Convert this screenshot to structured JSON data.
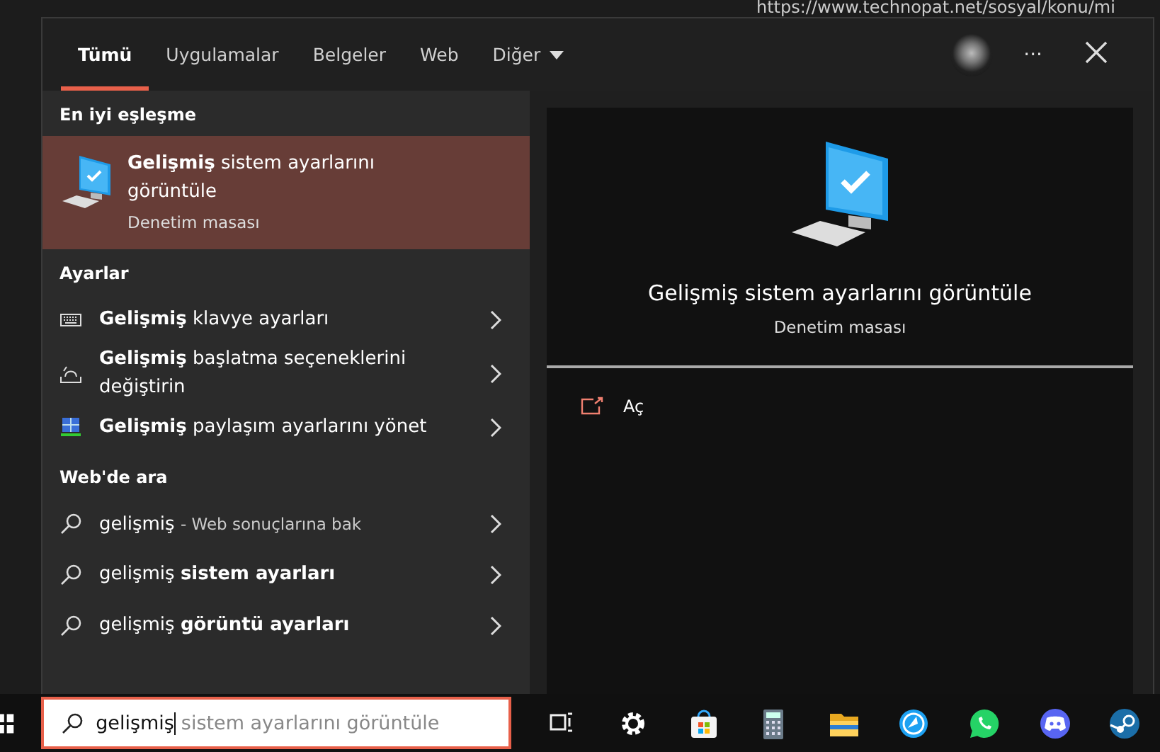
{
  "background_page": {
    "url": "https://www.technopat.net/sosyal/konu/mi"
  },
  "tabs": [
    {
      "label": "Tümü",
      "selected": true
    },
    {
      "label": "Uygulamalar",
      "selected": false
    },
    {
      "label": "Belgeler",
      "selected": false
    },
    {
      "label": "Web",
      "selected": false
    },
    {
      "label": "Diğer",
      "selected": false,
      "dropdown": true
    }
  ],
  "header_buttons": {
    "more": "···"
  },
  "best_match": {
    "heading": "En iyi eşleşme",
    "title": "**Gelişmiş** sistem ayarlarını görüntüle",
    "subtitle": "Denetim masası",
    "selected": true
  },
  "sections": [
    {
      "heading": "Ayarlar",
      "items": [
        {
          "kind": "keyboard",
          "text": "**Gelişmiş** klavye ayarları"
        },
        {
          "kind": "startup",
          "text": "**Gelişmiş** başlatma seçeneklerini değiştirin"
        },
        {
          "kind": "network",
          "text": "**Gelişmiş** paylaşım ayarlarını yönet"
        }
      ]
    },
    {
      "heading": "Web'de ara",
      "items": [
        {
          "kind": "search",
          "text": "gelişmiş",
          "hint": "- Web sonuçlarına bak"
        },
        {
          "kind": "search",
          "text": "gelişmiş **sistem ayarları**"
        },
        {
          "kind": "search",
          "text": "gelişmiş **görüntü ayarları**"
        }
      ]
    }
  ],
  "preview": {
    "title": "Gelişmiş sistem ayarlarını görüntüle",
    "subtitle": "Denetim masası",
    "actions": [
      {
        "label": "Aç"
      }
    ]
  },
  "search": {
    "value": "gelişmiş",
    "suggestion": "sistem ayarlarını görüntüle"
  },
  "taskbar": [
    {
      "kind": "taskview"
    },
    {
      "kind": "gear"
    },
    {
      "kind": "store"
    },
    {
      "kind": "calculator"
    },
    {
      "kind": "folder"
    },
    {
      "kind": "bluecircle"
    },
    {
      "kind": "whatsapp"
    },
    {
      "kind": "discord"
    },
    {
      "kind": "steam"
    }
  ]
}
